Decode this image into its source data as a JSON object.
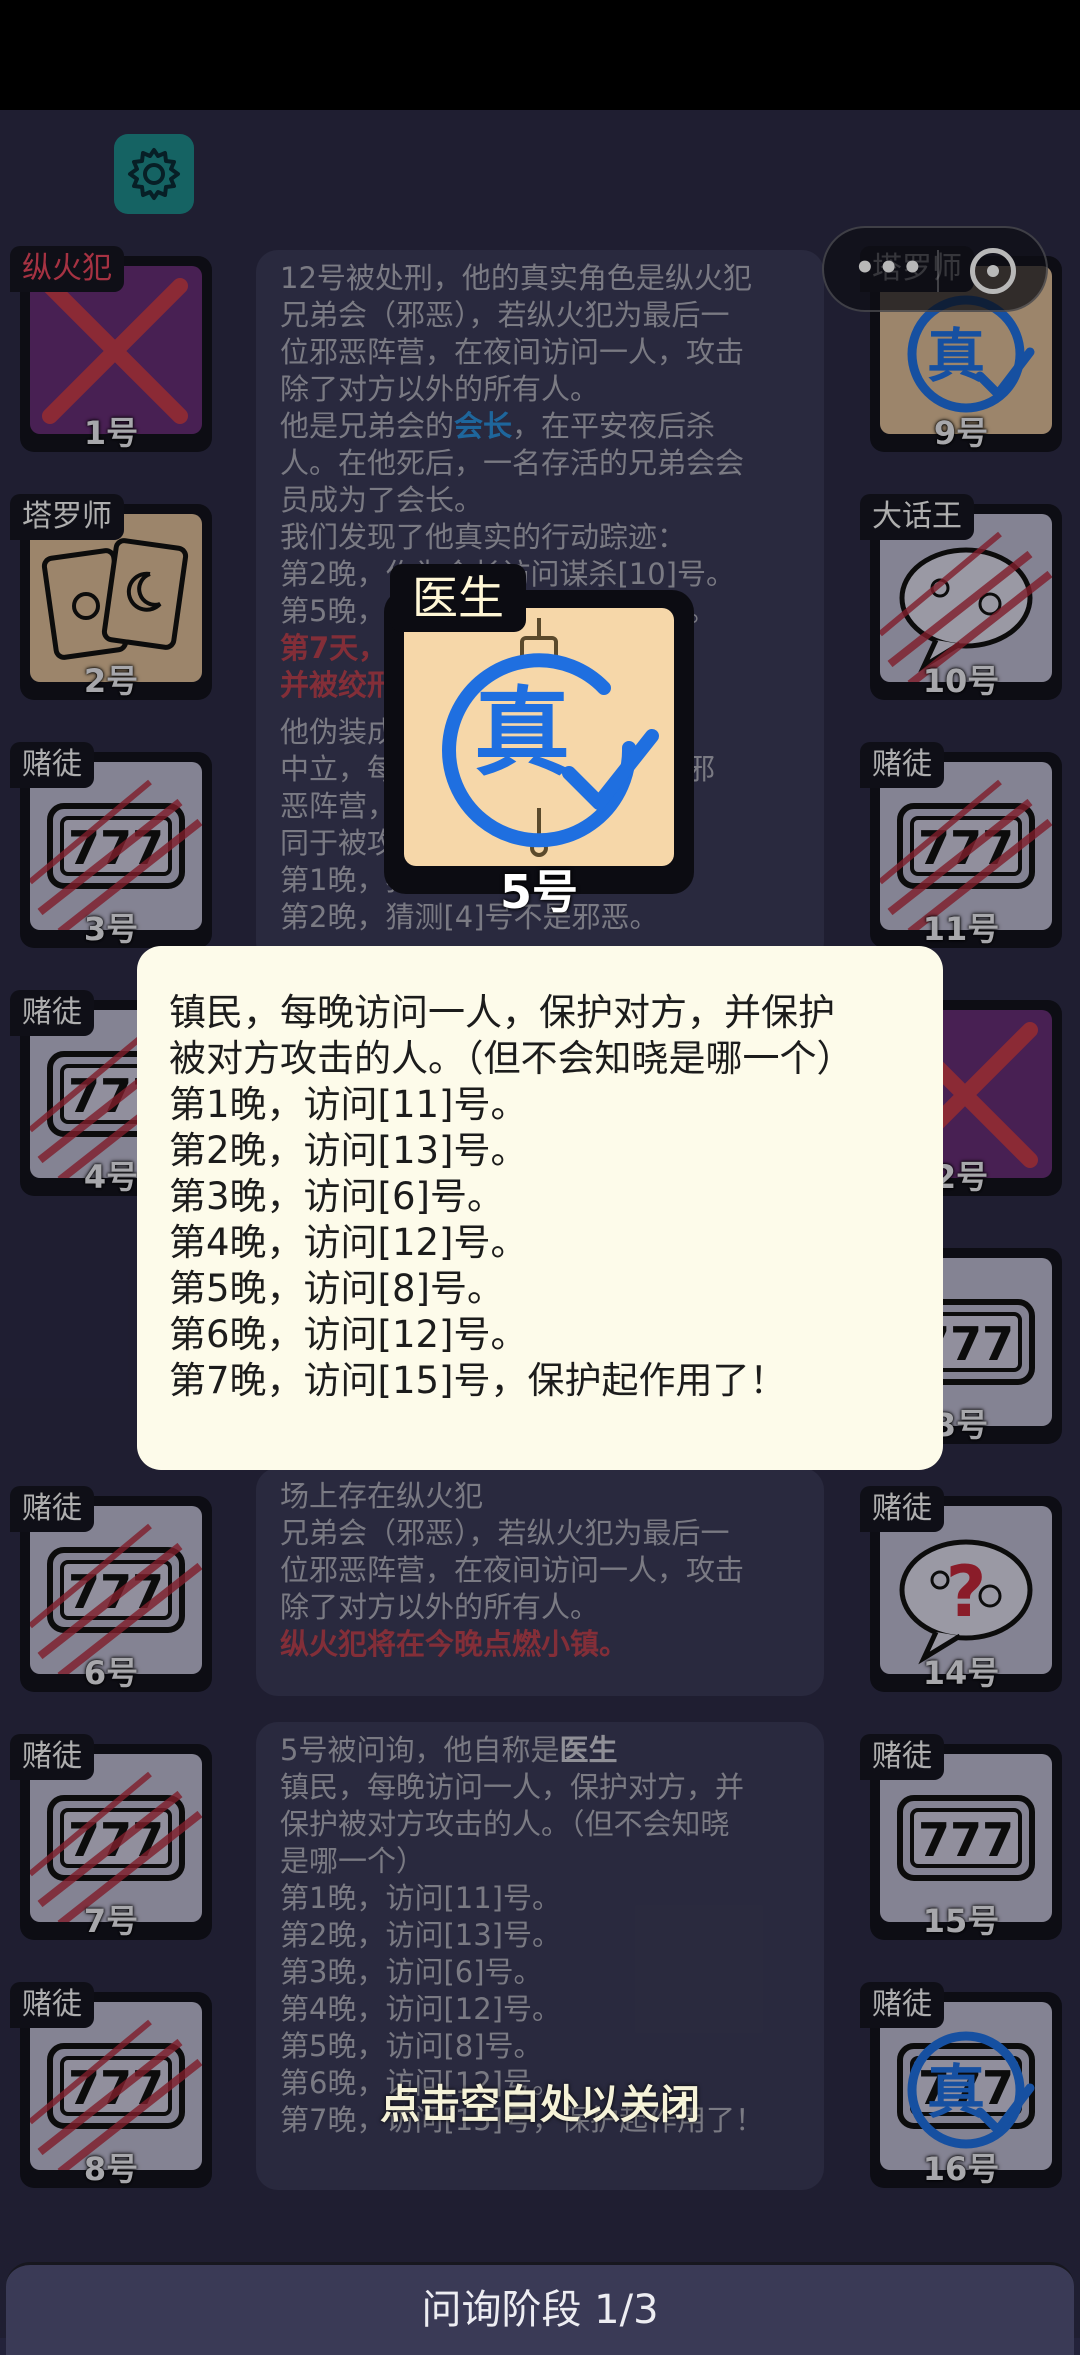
{
  "capsule": {
    "more": "•••"
  },
  "cards": [
    {
      "id": "c1",
      "role": "纵火犯",
      "role_red": true,
      "num": "1号",
      "bg": "purple",
      "mark": "x"
    },
    {
      "id": "c2",
      "role": "塔罗师",
      "role_red": false,
      "num": "2号",
      "bg": "tan",
      "mark": "tarot"
    },
    {
      "id": "c3",
      "role": "赌徒",
      "role_red": false,
      "num": "3号",
      "bg": "grey",
      "mark": "slot-scratch"
    },
    {
      "id": "c4",
      "role": "赌徒",
      "role_red": false,
      "num": "4号",
      "bg": "grey",
      "mark": "slot-scratch"
    },
    {
      "id": "c6",
      "role": "赌徒",
      "role_red": false,
      "num": "6号",
      "bg": "grey",
      "mark": "slot-scratch"
    },
    {
      "id": "c7",
      "role": "赌徒",
      "role_red": false,
      "num": "7号",
      "bg": "grey",
      "mark": "slot-scratch"
    },
    {
      "id": "c8",
      "role": "赌徒",
      "role_red": false,
      "num": "8号",
      "bg": "grey",
      "mark": "slot-scratch"
    },
    {
      "id": "c9",
      "role": "塔罗师",
      "role_red": false,
      "num": "9号",
      "bg": "tan",
      "mark": "true-stamp"
    },
    {
      "id": "c10",
      "role": "大话王",
      "role_red": false,
      "num": "10号",
      "bg": "grey",
      "mark": "bubble-scratch"
    },
    {
      "id": "c11",
      "role": "赌徒",
      "role_red": false,
      "num": "11号",
      "bg": "grey",
      "mark": "slot-scratch"
    },
    {
      "id": "c12",
      "role": "犯",
      "role_red": true,
      "num": "2号",
      "bg": "purple",
      "mark": "x"
    },
    {
      "id": "c13",
      "role": "",
      "role_red": false,
      "num": "3号",
      "bg": "grey",
      "mark": "slot"
    },
    {
      "id": "c14",
      "role": "赌徒",
      "role_red": false,
      "num": "14号",
      "bg": "grey",
      "mark": "bubble-question"
    },
    {
      "id": "c15",
      "role": "赌徒",
      "role_red": false,
      "num": "15号",
      "bg": "grey",
      "mark": "slot"
    },
    {
      "id": "c16",
      "role": "赌徒",
      "role_red": false,
      "num": "16号",
      "bg": "grey",
      "mark": "slot-true"
    }
  ],
  "log1": {
    "lines": [
      "12号被处刑，他的真实角色是纵火犯",
      "兄弟会（邪恶），若纵火犯为最后一",
      "位邪恶阵营，在夜间访问一人，攻击",
      "除了对方以外的所有人。"
    ],
    "leader_pre": "他是兄弟会的",
    "leader_word": "会长",
    "leader_post": "，在平安夜后杀",
    "lines2": [
      "人。在他死后，一名存活的兄弟会会",
      "员成为了会长。",
      "我们发现了他真实的行动踪迹：",
      "第2晚，作为会长访问谋杀[10]号。",
      "第5晚，作为会长访问谋杀[7]号。"
    ],
    "red1": "第7天，被判定为纵火犯有罪，",
    "red2": "并被绞刑。"
  },
  "log2": {
    "lines": [
      "他伪装成了赌徒",
      "中立，每晚猜测一名玩家是否为邪",
      "恶阵营，猜对则可攻击小镇（等",
      "同于被攻击）",
      "第1晚，猜测[2]号不是邪恶。",
      "第2晚，猜测[4]号不是邪恶。"
    ]
  },
  "log3": {
    "lines": [
      "场上存在纵火犯",
      "兄弟会（邪恶），若纵火犯为最后一",
      "位邪恶阵营，在夜间访问一人，攻击",
      "除了对方以外的所有人。"
    ],
    "red": "纵火犯将在今晚点燃小镇。"
  },
  "log4": {
    "intro_pre": "5号被问询，他自称是",
    "intro_role": "医生",
    "lines": [
      "镇民，每晚访问一人，保护对方，并",
      "保护被对方攻击的人。（但不会知晓",
      "是哪一个）",
      "第1晚，访问[11]号。",
      "第2晚，访问[13]号。",
      "第3晚，访问[6]号。",
      "第4晚，访问[12]号。",
      "第5晚，访问[8]号。",
      "第6晚，访问[12]号。",
      "第7晚，访问[15]号，保护起作用了！"
    ]
  },
  "bigcard": {
    "role": "医生",
    "num": "5号",
    "stamp": "真"
  },
  "popup": {
    "lines": [
      "镇民，每晚访问一人，保护对方，并保护",
      "被对方攻击的人。（但不会知晓是哪一个）",
      "第1晚，访问[11]号。",
      "第2晚，访问[13]号。",
      "第3晚，访问[6]号。",
      "第4晚，访问[12]号。",
      "第5晚，访问[8]号。",
      "第6晚，访问[12]号。",
      "第7晚，访问[15]号，保护起作用了！"
    ]
  },
  "hint": "点击空白处以关闭",
  "phase": "问询阶段 1/3"
}
